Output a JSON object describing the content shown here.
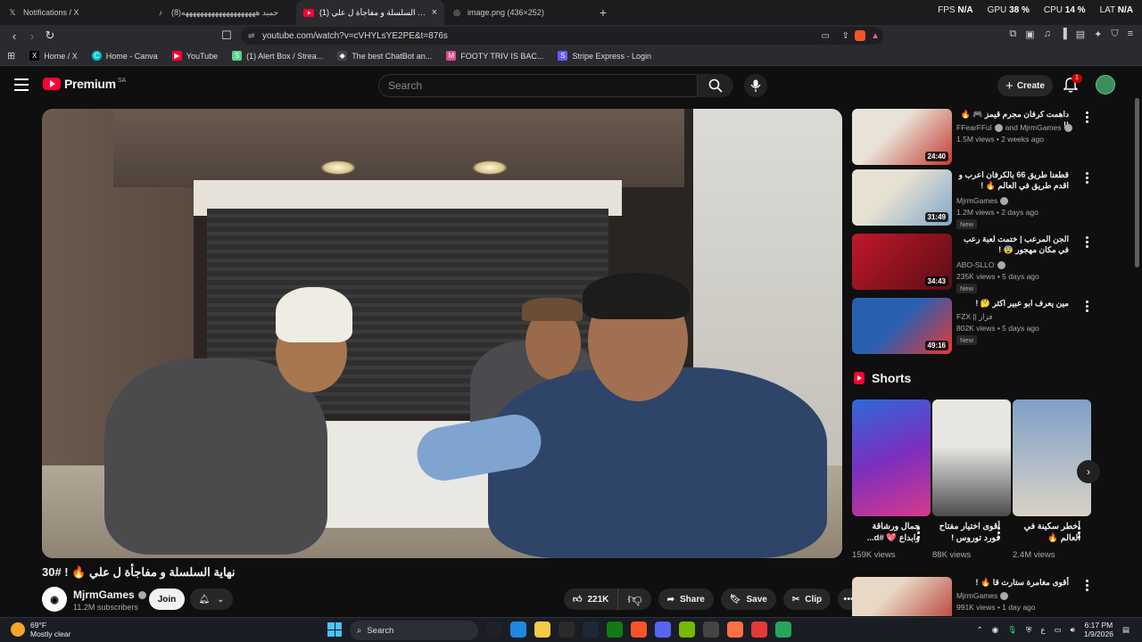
{
  "browser": {
    "tabs": [
      {
        "label": "Notifications / X",
        "icon": "x-logo-icon",
        "active": false
      },
      {
        "label": "(8)حميد ههههههههههههههههههههه",
        "icon": "tiktok-icon",
        "active": false
      },
      {
        "label": "(1) نهاية السلسلة و مفاجأة ل علي !",
        "icon": "youtube-icon",
        "active": true
      },
      {
        "label": "image.png (436×252)",
        "icon": "globe-icon",
        "active": false
      }
    ],
    "new_tab": "+",
    "stats": [
      {
        "label": "FPS",
        "value": "N/A"
      },
      {
        "label": "GPU",
        "value": "38 %"
      },
      {
        "label": "CPU",
        "value": "14 %"
      },
      {
        "label": "LAT",
        "value": "N/A"
      }
    ],
    "url": "youtube.com/watch?v=cVHYLsYE2PE&t=876s",
    "bookmarks": [
      {
        "label": "Home / X",
        "color": "#000000",
        "glyph": "X"
      },
      {
        "label": "Home - Canva",
        "color": "#00c4cc",
        "glyph": "C"
      },
      {
        "label": "YouTube",
        "color": "#ff0033",
        "glyph": "▶"
      },
      {
        "label": "(1) Alert Box / Strea...",
        "color": "#53d28c",
        "glyph": "S"
      },
      {
        "label": "The best ChatBot an...",
        "color": "#444444",
        "glyph": "◆"
      },
      {
        "label": "FOOTY TRIV IS BAC...",
        "color": "#e24a8d",
        "glyph": "M"
      },
      {
        "label": "Stripe Express - Login",
        "color": "#635bff",
        "glyph": "S"
      }
    ]
  },
  "masthead": {
    "logo": "Premium",
    "region": "SA",
    "search_placeholder": "Search",
    "create_label": "Create",
    "notif_count": "1"
  },
  "video": {
    "title": "نهاية السلسلة و مفاجأة ل علي 🔥 ! #30",
    "channel": "MjrmGames",
    "subscribers": "11.2M subscribers",
    "join_label": "Join",
    "likes": "221K",
    "share_label": "Share",
    "save_label": "Save",
    "clip_label": "Clip"
  },
  "recommendations": [
    {
      "title": "داهمت كرفان مجرم قيمز 🎮 🔥 !!",
      "channel": "FFearFFul",
      "channel2": "and MjrmGames",
      "views": "1.5M views",
      "age": "2 weeks ago",
      "duration": "24:40",
      "new": "",
      "colors": [
        "#c43a2f",
        "#e8e2d8"
      ]
    },
    {
      "title": "قطعنا طريق 66 بالكرفان اعرب و اقدم طريق في العالم 🔥 !",
      "channel": "MjrmGames",
      "channel2": "",
      "views": "1.2M views",
      "age": "2 days ago",
      "duration": "31:49",
      "new": "New",
      "colors": [
        "#7fa7c9",
        "#e7e1d3"
      ]
    },
    {
      "title": "الجن المرعب | ختمت لعبة رعب في مكان مهجور 😨 !",
      "channel": "ABO-SLLO",
      "channel2": "",
      "views": "235K views",
      "age": "5 days ago",
      "duration": "34:43",
      "new": "New",
      "colors": [
        "#5a0d14",
        "#c2182b"
      ]
    },
    {
      "title": "مين يعرف ابو عبير اكثر 🤔 !",
      "channel": "FZX || فزاز",
      "channel2": "",
      "views": "802K views",
      "age": "5 days ago",
      "duration": "49:16",
      "new": "New",
      "colors": [
        "#2a5fb0",
        "#e53935"
      ]
    }
  ],
  "shorts": {
    "header": "Shorts",
    "items": [
      {
        "title": "جمال ورشاقة وابداع 💖 #d...",
        "views": "159K views",
        "colors": [
          "#2d6ad8",
          "#d6398b"
        ]
      },
      {
        "title": "أقوى اختيار مفتاح فورد توروس !",
        "views": "88K views",
        "colors": [
          "#e8e6e1",
          "#4b4b4b"
        ]
      },
      {
        "title": "أخطر سكينة في العالم 🔥",
        "views": "2.4M views",
        "colors": [
          "#7fa0c7",
          "#d9d2c7"
        ]
      }
    ]
  },
  "next_rec": {
    "title": "أقوى مغامرة ستارت قا 🔥 !",
    "channel": "MjrmGames",
    "views": "991K views",
    "age": "1 day ago",
    "colors": [
      "#b2302a",
      "#e8d8c5"
    ]
  },
  "taskbar": {
    "temp": "69°F",
    "weather": "Mostly clear",
    "search": "Search",
    "time": "6:17 PM",
    "date": "1/9/2026",
    "lang": "ع",
    "apps": [
      "#1f1f2a",
      "#1e88e5",
      "#f7c948",
      "#2b2b2b",
      "#1b2838",
      "#107c10",
      "#fb542b",
      "#5865f2",
      "#76b900",
      "#444444",
      "#ff7043",
      "#e53935",
      "#26a65b"
    ]
  }
}
